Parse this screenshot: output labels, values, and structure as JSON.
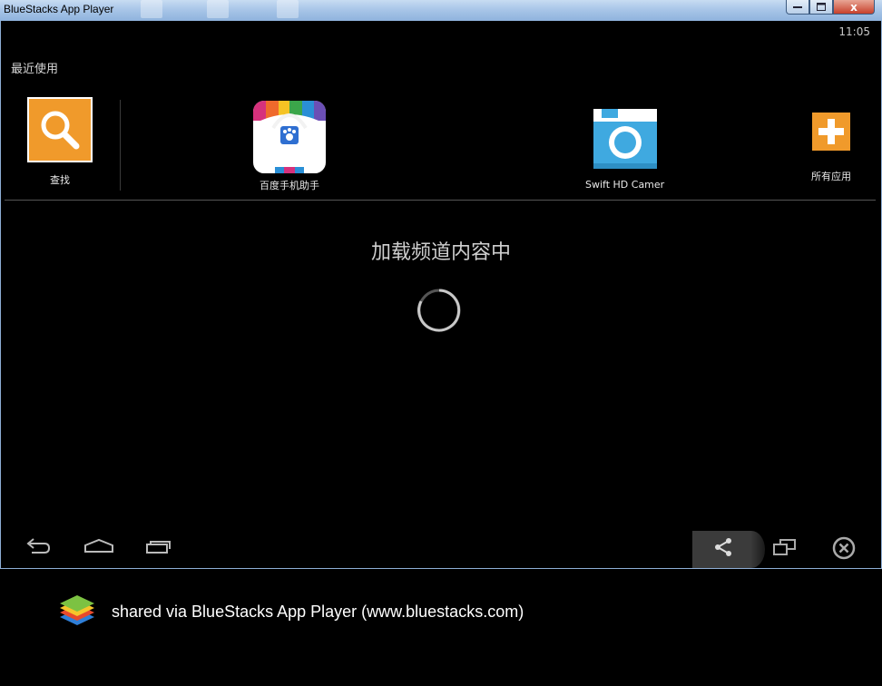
{
  "window": {
    "title": "BlueStacks App Player",
    "minimize_icon": "minimize-icon",
    "maximize_icon": "maximize-icon",
    "close_icon": "close-icon",
    "close_glyph": "x"
  },
  "status": {
    "time": "11:05"
  },
  "recent": {
    "label": "最近使用",
    "apps": [
      {
        "label": "查找",
        "icon": "search-icon",
        "color": "#f09a2b"
      },
      {
        "label": "百度手机助手",
        "icon": "baidu-assistant-icon"
      },
      {
        "label": "Swift HD Camer",
        "icon": "camera-icon",
        "color": "#3fa9e0"
      },
      {
        "label": "所有应用",
        "icon": "plus-icon",
        "color": "#f09a2b"
      }
    ]
  },
  "main": {
    "loading_text": "加载频道内容中"
  },
  "navbar": {
    "back_icon": "back-icon",
    "home_icon": "home-icon",
    "recents_icon": "recent-apps-icon",
    "share_icon": "share-icon",
    "rotate_icon": "rotate-screen-icon",
    "close_icon": "close-circle-icon"
  },
  "banner": {
    "text": "shared via BlueStacks App Player (www.bluestacks.com)",
    "logo": "bluestacks-logo"
  }
}
